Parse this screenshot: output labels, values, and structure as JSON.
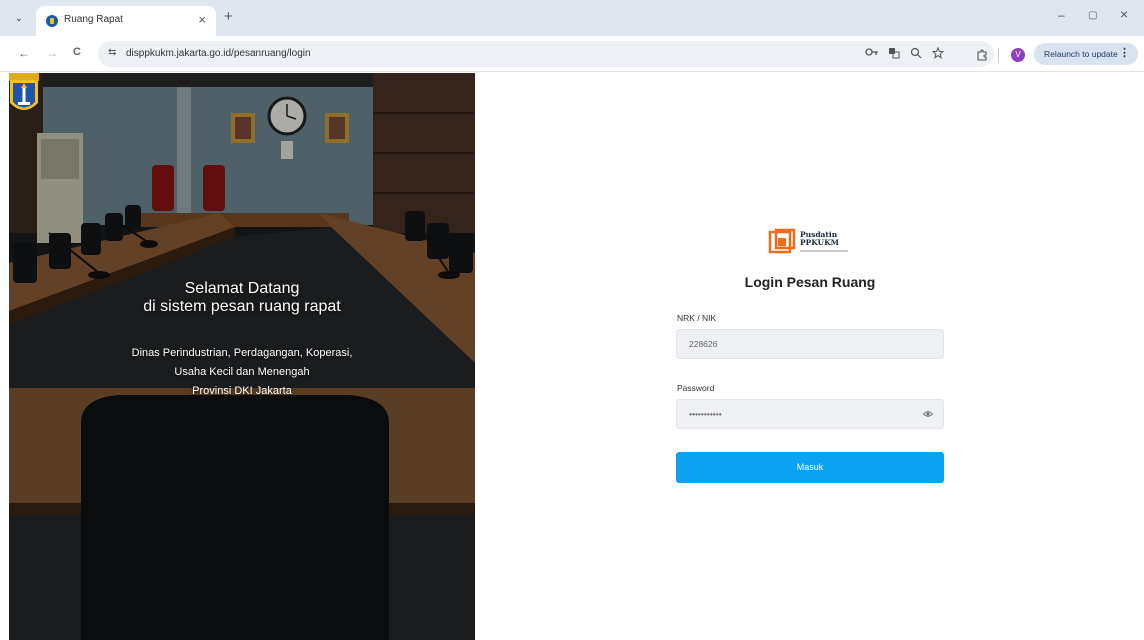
{
  "browser": {
    "tab_title": "Ruang Rapat",
    "tab_close": "×",
    "new_tab": "+",
    "tab_dropdown": "⌄",
    "url": "disppkukm.jakarta.go.id/pesanruang/login",
    "profile_initial": "V",
    "relaunch_label": "Relaunch to update",
    "relaunch_menu": "⋮",
    "nav": {
      "back": "←",
      "forward": "→",
      "reload": "C"
    },
    "site_info_icon": "⇆",
    "window_controls": {
      "minimize": "–",
      "restore": "▢",
      "close": "×"
    },
    "omnibox_icons": [
      "key-icon",
      "translate-icon",
      "zoom-icon",
      "star-icon"
    ],
    "extension_icons": [
      "puzzle-icon"
    ]
  },
  "hero": {
    "welcome_line1": "Selamat Datang",
    "welcome_line2": "di sistem pesan ruang rapat",
    "org_line1": "Dinas Perindustrian, Perdagangan, Koperasi,",
    "org_line2": "Usaha Kecil dan Menengah",
    "org_line3": "Provinsi DKI Jakarta",
    "emblem": "dki-jakarta-emblem"
  },
  "login": {
    "brand_line1": "Pusdatin",
    "brand_line2": "PPKUKM",
    "title": "Login Pesan Ruang",
    "nrk_label": "NRK / NIK",
    "nrk_value": "228626",
    "password_label": "Password",
    "password_value": "•••••••••••",
    "submit_label": "Masuk"
  },
  "colors": {
    "accent": "#0aa2f3",
    "brand_orange": "#f26a1b",
    "chrome_bg": "#dfe6ef"
  }
}
